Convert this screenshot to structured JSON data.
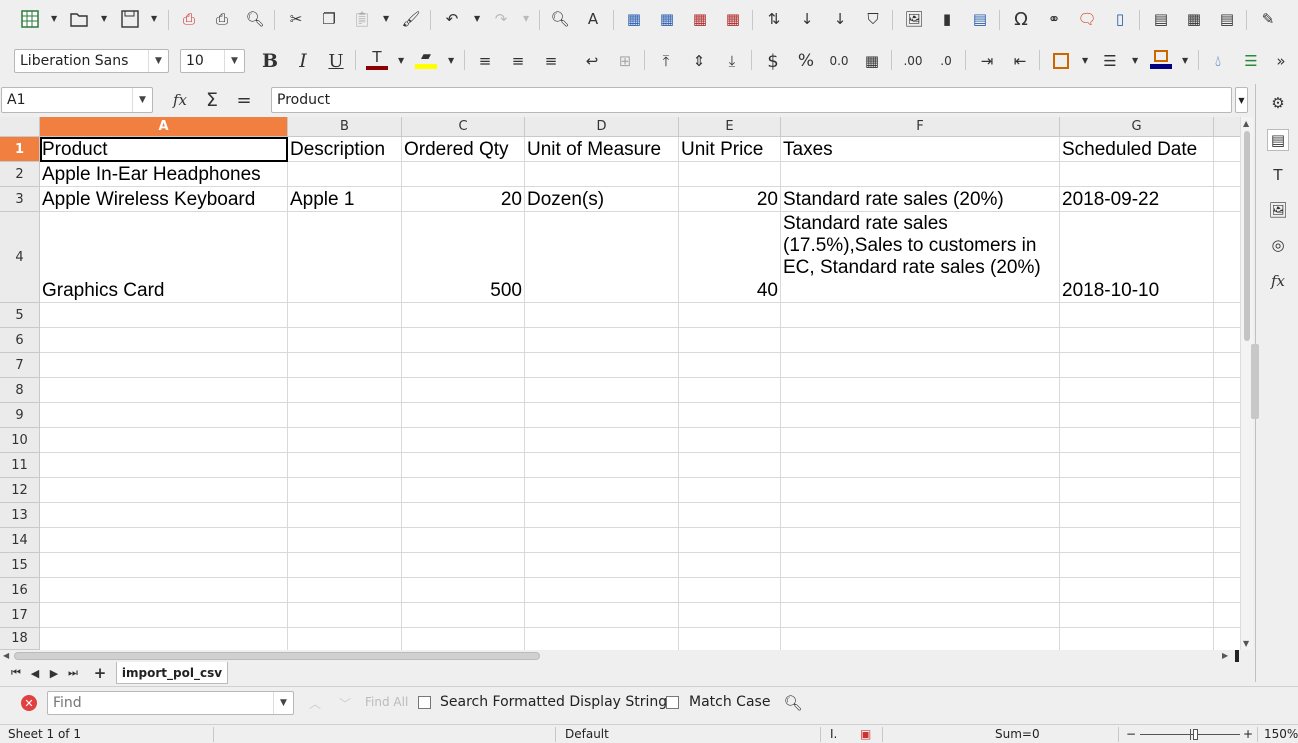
{
  "toolbar": {
    "font_name": "Liberation Sans",
    "font_size": "10",
    "icons_row1": [
      "new-spreadsheet-icon",
      "open-icon",
      "save-icon",
      "export-pdf-icon",
      "print-icon",
      "print-preview-icon",
      "cut-icon",
      "copy-icon",
      "paste-icon",
      "clone-formatting-icon",
      "undo-icon",
      "redo-icon",
      "find-replace-icon",
      "spelling-icon",
      "row-icon",
      "column-icon",
      "delete-row-icon",
      "delete-column-icon",
      "sort-icon",
      "sort-ascending-icon",
      "sort-descending-icon",
      "autofilter-icon",
      "image-icon",
      "chart-icon",
      "pivot-table-icon",
      "special-character-icon",
      "hyperlink-icon",
      "comment-icon",
      "headers-footers-icon",
      "define-print-area-icon",
      "freeze-icon",
      "split-window-icon",
      "draw-functions-icon"
    ],
    "font_color": "#8b0000",
    "highlight_color": "#ffff00",
    "border_color": "#cc6600",
    "cell_bg_color": "#000080"
  },
  "formula_bar": {
    "name_box": "A1",
    "content": "Product"
  },
  "grid": {
    "columns": [
      {
        "label": "A"
      },
      {
        "label": "B"
      },
      {
        "label": "C"
      },
      {
        "label": "D"
      },
      {
        "label": "E"
      },
      {
        "label": "F"
      },
      {
        "label": "G"
      }
    ],
    "rows": [
      "1",
      "2",
      "3",
      "4",
      "5",
      "6",
      "7",
      "8",
      "9",
      "10",
      "11",
      "12",
      "13",
      "14",
      "15",
      "16",
      "17",
      "18"
    ],
    "cells": {
      "r1": [
        "Product",
        "Description",
        "Ordered Qty",
        "Unit of Measure",
        "Unit Price",
        "Taxes",
        "Scheduled Date"
      ],
      "r2": [
        "Apple In-Ear Headphones",
        "",
        "",
        "",
        "",
        "",
        ""
      ],
      "r3": [
        "Apple Wireless Keyboard",
        "Apple 1",
        "20",
        "Dozen(s)",
        "20",
        "Standard rate sales (20%)",
        "2018-09-22"
      ],
      "r4": [
        "Graphics Card",
        "",
        "500",
        "",
        "40",
        "Standard rate sales (17.5%),Sales to customers in EC, Standard rate sales (20%)",
        "2018-10-10"
      ]
    }
  },
  "sheet_tabs": {
    "active": "import_pol_csv"
  },
  "findbar": {
    "placeholder": "Find",
    "find_all": "Find All",
    "search_formatted": "Search Formatted Display String",
    "match_case": "Match Case"
  },
  "status": {
    "sheet": "Sheet 1 of 1",
    "style": "Default",
    "sum": "Sum=0",
    "zoom": "150%"
  }
}
